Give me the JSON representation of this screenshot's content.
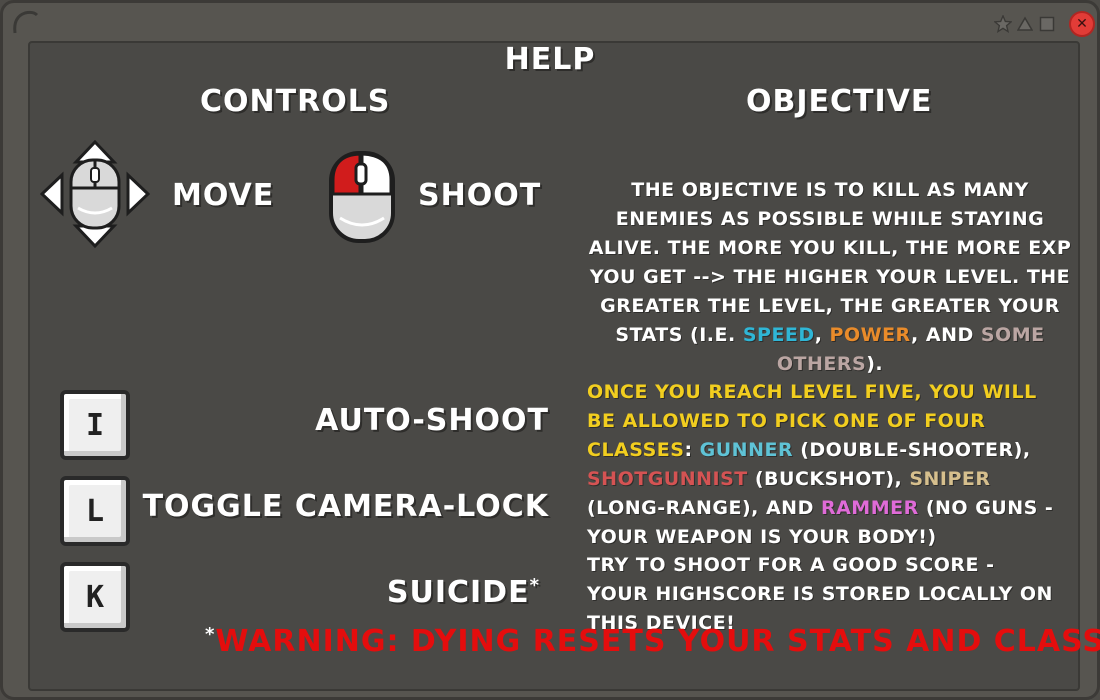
{
  "window": {
    "close_symbol": "✕",
    "icons": [
      "corner-ornament-icon",
      "star-icon",
      "triangle-icon",
      "square-icon",
      "close-icon"
    ]
  },
  "help": {
    "title": "HELP",
    "controls_heading": "CONTROLS",
    "objective_heading": "OBJECTIVE",
    "move_label": "MOVE",
    "shoot_label": "SHOOT",
    "keys": [
      {
        "key": "I",
        "action": "AUTO-SHOOT"
      },
      {
        "key": "L",
        "action": "TOGGLE CAMERA-LOCK"
      },
      {
        "key": "K",
        "action": "SUICIDE"
      }
    ],
    "suicide_marker": "*",
    "objective": {
      "p1_a": "THE OBJECTIVE IS TO KILL AS MANY ENEMIES AS POSSIBLE WHILE STAYING ALIVE. THE MORE YOU KILL, THE MORE EXP YOU GET --> THE HIGHER YOUR LEVEL. THE GREATER THE LEVEL, THE GREATER YOUR STATS (I.E. ",
      "speed": "SPEED",
      "comma1": ", ",
      "power": "POWER",
      "and": ", AND ",
      "some_others": "SOME OTHERS",
      "p1_end": ").",
      "p2_intro": "ONCE YOU REACH LEVEL FIVE, YOU WILL BE ALLOWED TO PICK ONE OF FOUR CLASSES",
      "colon": ": ",
      "gunner": "GUNNER",
      "gunner_desc": " (DOUBLE-SHOOTER), ",
      "shotgunnist": "SHOTGUNNIST",
      "shotgunnist_desc": " (BUCKSHOT), ",
      "sniper": "SNIPER",
      "sniper_desc": " (LONG-RANGE), AND ",
      "rammer": "RAMMER",
      "rammer_desc": " (NO GUNS - YOUR WEAPON IS YOUR BODY!)",
      "p3": "TRY TO SHOOT FOR A GOOD SCORE - YOUR HIGHSCORE IS STORED LOCALLY ON THIS DEVICE!"
    },
    "warning_marker": "*",
    "warning": "WARNING: DYING RESETS YOUR STATS AND CLASS"
  },
  "colors": {
    "speed": "#2fb6d6",
    "power": "#e98b2a",
    "some_others": "#bba6a3",
    "class_intro": "#f2ce1f",
    "gunner": "#5fc3d6",
    "shotgunnist": "#d55353",
    "sniper": "#d6bf8d",
    "rammer": "#e06bd8",
    "warning": "#e40d0d"
  }
}
